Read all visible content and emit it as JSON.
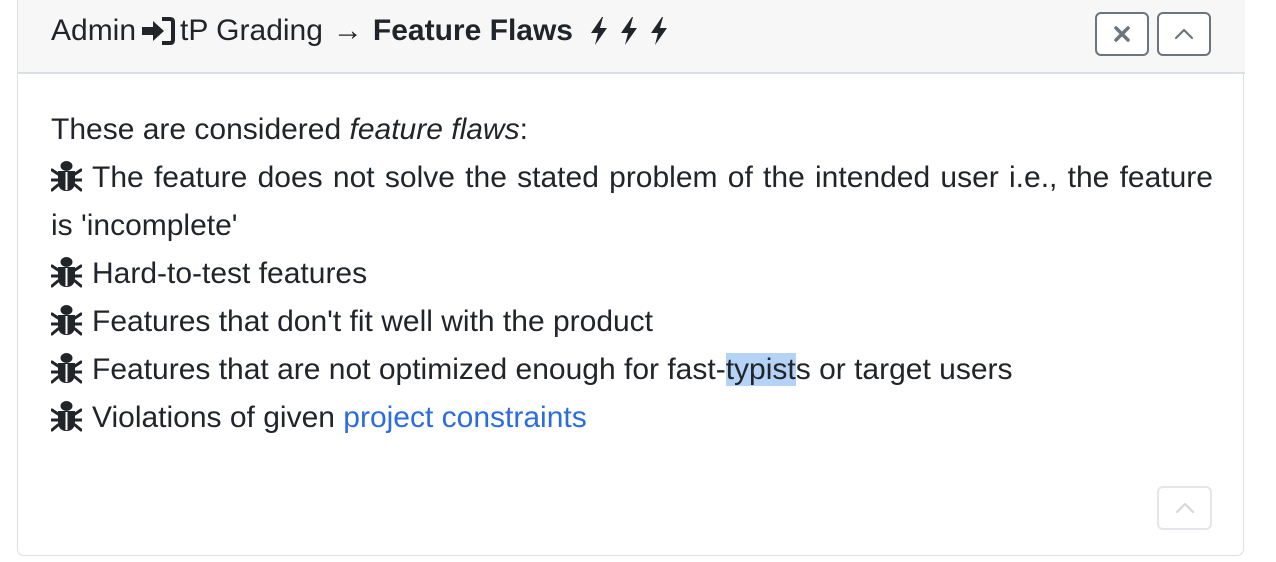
{
  "header": {
    "breadcrumb_admin": "Admin",
    "breadcrumb_section": "tP Grading",
    "breadcrumb_arrow": "→",
    "page_title": "Feature Flaws",
    "icons": [
      "login-icon",
      "bolt-icon",
      "close-icon",
      "chevron-up-icon"
    ]
  },
  "content": {
    "intro_prefix": "These are considered ",
    "intro_emphasis": "feature flaws",
    "intro_suffix": ":",
    "items": [
      {
        "text": "The feature does not solve the stated problem of the intended user i.e., the feature is 'incomplete'"
      },
      {
        "text": "Hard-to-test features"
      },
      {
        "text": "Features that don't fit well with the product"
      },
      {
        "text_before": "Features that are not optimized enough for fast-",
        "text_selected": "typist",
        "text_after": "s or target users"
      },
      {
        "text_before": "Violations of given ",
        "link": "project constraints"
      }
    ]
  },
  "colors": {
    "link": "#2b6de0",
    "selection": "#b4d3f6",
    "header_bg": "#f7f7f7"
  }
}
